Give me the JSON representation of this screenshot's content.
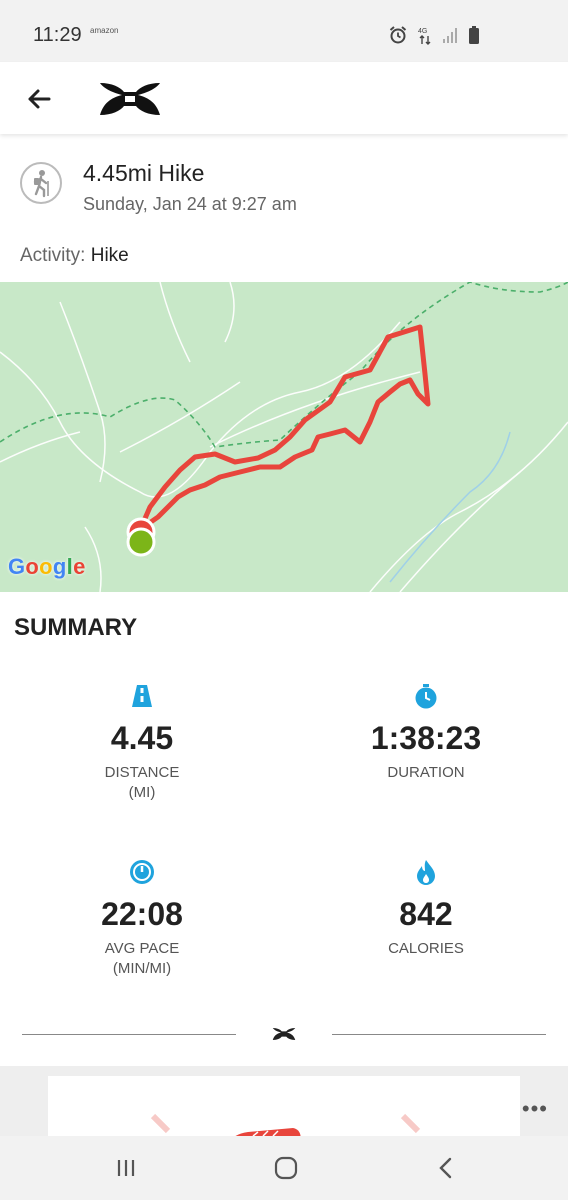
{
  "status_bar": {
    "time": "11:29",
    "notification": "amazon",
    "icons": [
      "alarm-icon",
      "data-icon",
      "signal-icon",
      "battery-icon"
    ]
  },
  "app_bar": {
    "back_icon": "arrow-left-icon",
    "logo": "under-armour-logo"
  },
  "activity": {
    "icon": "hiker-icon",
    "title": "4.45mi Hike",
    "date": "Sunday, Jan 24 at 9:27 am",
    "type_label": "Activity:",
    "type_value": "Hike"
  },
  "map": {
    "attribution": "Google",
    "route_color": "#e8453c",
    "start_marker_color": "#7cb518"
  },
  "summary": {
    "title": "SUMMARY",
    "stats": [
      {
        "icon": "road-icon",
        "value": "4.45",
        "label": "DISTANCE",
        "unit": "(MI)"
      },
      {
        "icon": "stopwatch-icon",
        "value": "1:38:23",
        "label": "DURATION",
        "unit": ""
      },
      {
        "icon": "speedometer-icon",
        "value": "22:08",
        "label": "AVG PACE",
        "unit": "(MIN/MI)"
      },
      {
        "icon": "flame-icon",
        "value": "842",
        "label": "CALORIES",
        "unit": ""
      }
    ]
  },
  "promo": {
    "more_icon": "more-horizontal-icon"
  },
  "nav_bar": {
    "buttons": [
      "recent-apps-icon",
      "home-icon",
      "back-icon"
    ]
  },
  "colors": {
    "accent_blue": "#1fa3dd",
    "route_red": "#e8453c",
    "map_green": "#c8e8c8"
  }
}
